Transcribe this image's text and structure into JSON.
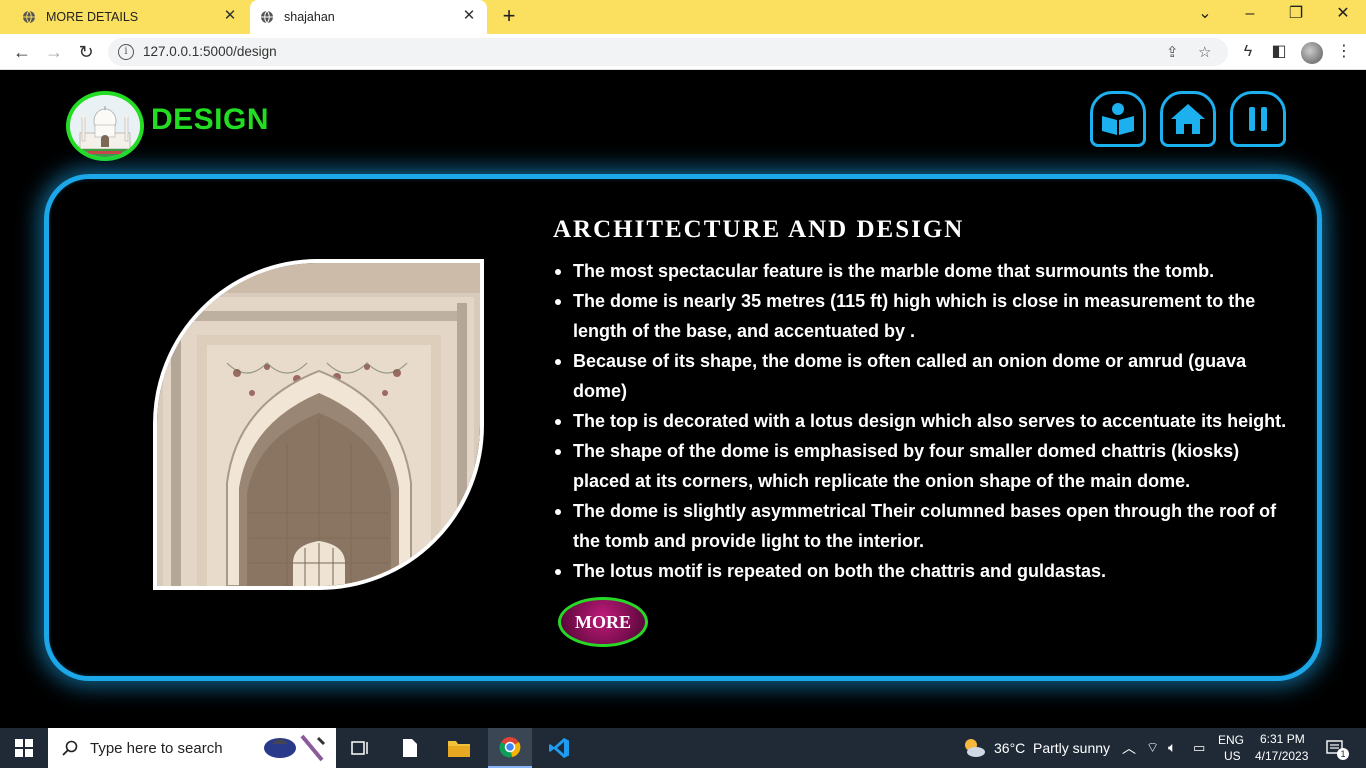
{
  "browser": {
    "tabs": [
      {
        "title": "MORE DETAILS",
        "active": false
      },
      {
        "title": "shajahan",
        "active": true
      }
    ],
    "url": "127.0.0.1:5000/design"
  },
  "page": {
    "logo_title": "DESIGN",
    "nav_icons": [
      "book-reader-icon",
      "home-icon",
      "pause-icon"
    ],
    "heading": "ARCHITECTURE AND DESIGN",
    "points": [
      "The most spectacular feature is the marble dome that surmounts the tomb.",
      "The dome is nearly 35 metres (115 ft) high which is close in measurement to the length of the base, and accentuated by .",
      "Because of its shape, the dome is often called an onion dome or amrud (guava dome)",
      "The top is decorated with a lotus design which also serves to accentuate its height.",
      "The shape of the dome is emphasised by four smaller domed chattris (kiosks) placed at its corners, which replicate the onion shape of the main dome.",
      "The dome is slightly asymmetrical Their columned bases open through the roof of the tomb and provide light to the interior.",
      "The lotus motif is repeated on both the chattris and guldastas."
    ],
    "more_label": "MORE",
    "colors": {
      "accent_green": "#22dd22",
      "panel_blue": "#1ba7e8",
      "button_magenta": "#c01a7a"
    }
  },
  "taskbar": {
    "search_placeholder": "Type here to search",
    "weather_temp": "36°C",
    "weather_desc": "Partly sunny",
    "lang_line1": "ENG",
    "lang_line2": "US",
    "time": "6:31 PM",
    "date": "4/17/2023",
    "notif_count": "1"
  }
}
